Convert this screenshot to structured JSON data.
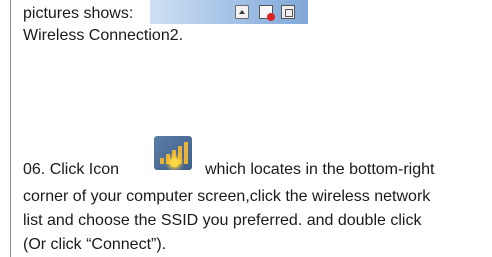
{
  "step_intro": {
    "line1_text": "pictures shows:",
    "line2_text": "Wireless Connection2."
  },
  "tray_icons": [
    "show-hidden-icons-arrow",
    "network-disconnected-icon",
    "settings-icon"
  ],
  "step_06": {
    "lead_text": "06. Click Icon",
    "icon_name": "wireless-signal-icon",
    "after_icon_text": "which locates in the bottom-right",
    "line2_text": "corner of your computer screen,click the wireless network",
    "line3_text": "list and choose the SSID you preferred. and double click",
    "line4_text": "(Or click “Connect”)."
  },
  "colors": {
    "text": "#1a1a1a",
    "tray_background": "#a9c6e8",
    "wifi_icon_bars": "#e8b33a"
  }
}
